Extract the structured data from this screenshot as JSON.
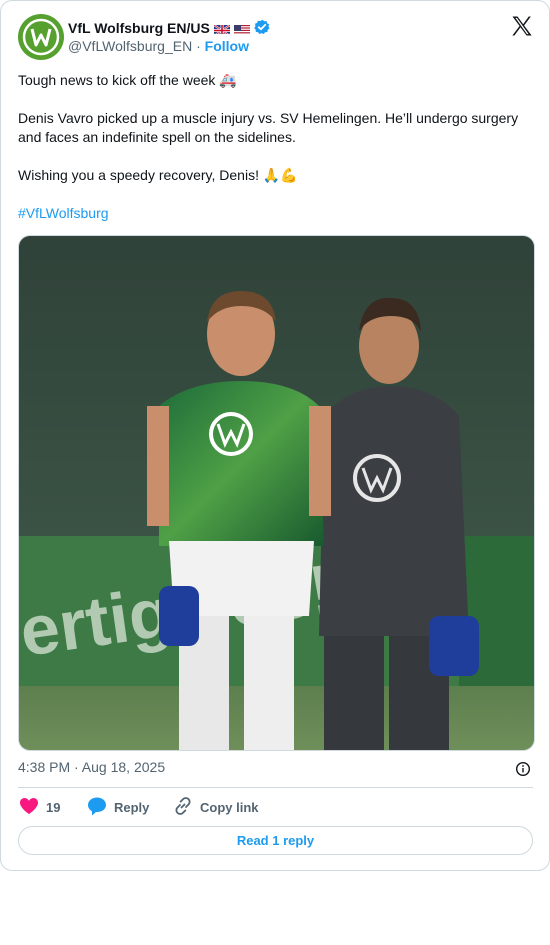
{
  "author": {
    "name": "VfL Wolfsburg EN/US",
    "handle": "@VfLWolfsburg_EN",
    "separator": "·",
    "follow_label": "Follow",
    "avatar_letter": "W",
    "flags": [
      "uk-flag-icon",
      "us-flag-icon"
    ],
    "verified_icon": "verified-badge-icon"
  },
  "tweet": {
    "line1": "Tough news to kick off the week 🚑",
    "line2": "Denis Vavro picked up a muscle injury vs. SV Hemelingen. He’ll undergo surgery and faces an indefinite spell on the sidelines.",
    "line3": "Wishing you a speedy recovery, Denis! 🙏💪",
    "hashtag": "#VfLWolfsburg"
  },
  "media": {
    "description_icon": "photo-of-injured-player-walking-with-staff"
  },
  "meta": {
    "time": "4:38 PM · Aug 18, 2025"
  },
  "actions": {
    "like_count": "19",
    "reply_label": "Reply",
    "copy_label": "Copy link"
  },
  "read_reply": "Read 1 reply",
  "colors": {
    "accent": "#1d9bf0",
    "like": "#f91880",
    "wolfsburg_green": "#56a02f",
    "muted": "#536471",
    "border": "#cfd9de"
  }
}
